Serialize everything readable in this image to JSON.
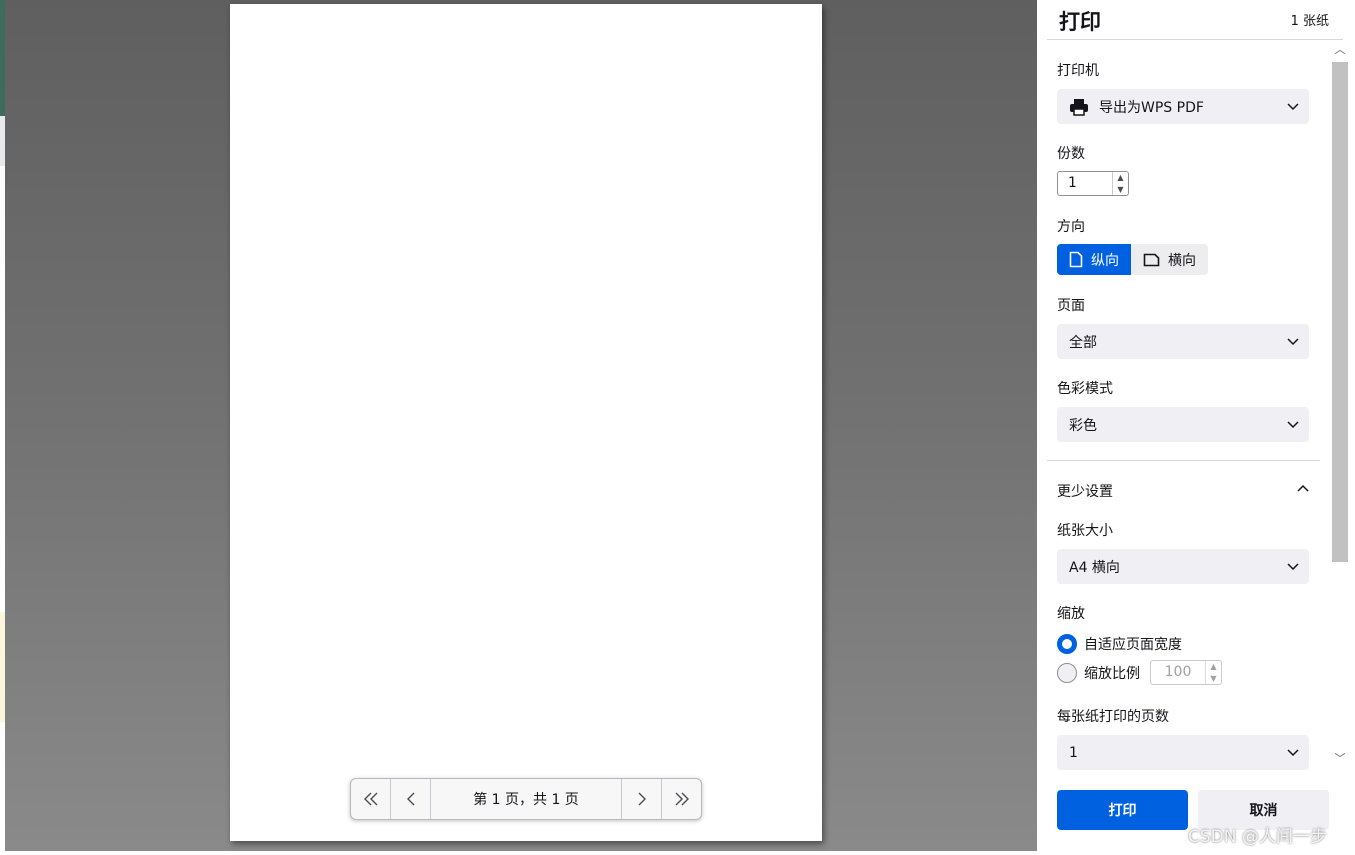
{
  "panel": {
    "title": "打印",
    "sheet_count": "1 张纸",
    "printer": {
      "label": "打印机",
      "value": "导出为WPS PDF"
    },
    "copies": {
      "label": "份数",
      "value": "1"
    },
    "orientation": {
      "label": "方向",
      "portrait": "纵向",
      "landscape": "横向",
      "selected": "纵向"
    },
    "pages": {
      "label": "页面",
      "value": "全部"
    },
    "color_mode": {
      "label": "色彩模式",
      "value": "彩色"
    },
    "less_settings": "更少设置",
    "paper_size": {
      "label": "纸张大小",
      "value": "A4 横向"
    },
    "scale": {
      "label": "缩放",
      "fit_option": "自适应页面宽度",
      "scale_option": "缩放比例",
      "scale_value": "100",
      "selected": "自适应页面宽度"
    },
    "pages_per_sheet": {
      "label": "每张纸打印的页数",
      "value": "1"
    },
    "print_button": "打印",
    "cancel_button": "取消"
  },
  "preview": {
    "page_indicator": "第 1 页，共 1 页"
  },
  "watermark": "CSDN @人间一步",
  "colors": {
    "accent": "#0061e0",
    "panel_bg": "#ffffff",
    "overlay": "#6b6b6b"
  }
}
